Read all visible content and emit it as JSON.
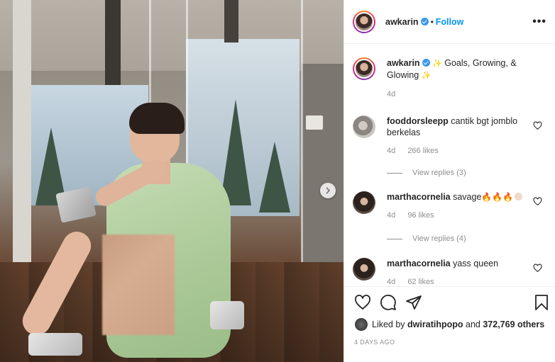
{
  "post": {
    "username": "awkarin",
    "follow_label": "Follow",
    "more_label": "•••",
    "next_label": "›"
  },
  "caption": {
    "username": "awkarin",
    "text": "Goals, Growing, &",
    "text2": "Glowing",
    "age": "4d"
  },
  "comments": [
    {
      "username": "fooddorsleepp",
      "text": "cantik bgt jomblo",
      "text2": "berkelas",
      "age": "4d",
      "likes": "266 likes",
      "replies": "View replies (3)"
    },
    {
      "username": "marthacornelia",
      "text": "savage",
      "age": "4d",
      "likes": "96 likes",
      "replies": "View replies (4)"
    },
    {
      "username": "marthacornelia",
      "text": "yass queen",
      "age": "4d",
      "likes": "62 likes"
    }
  ],
  "footer": {
    "liked_prefix": "Liked by",
    "liked_user": "dwiratihpopo",
    "liked_and": "and",
    "liked_count": "372,769 others",
    "date": "4 DAYS AGO"
  },
  "icons": {
    "heart": "heart-icon",
    "comment": "comment-icon",
    "share": "share-icon",
    "save": "bookmark-icon",
    "verified": "verified-badge-icon",
    "chevron": "chevron-right-icon"
  },
  "colors": {
    "link": "#0095f6",
    "verified": "#3897f0",
    "muted": "#8e8e8e",
    "text": "#262626"
  }
}
